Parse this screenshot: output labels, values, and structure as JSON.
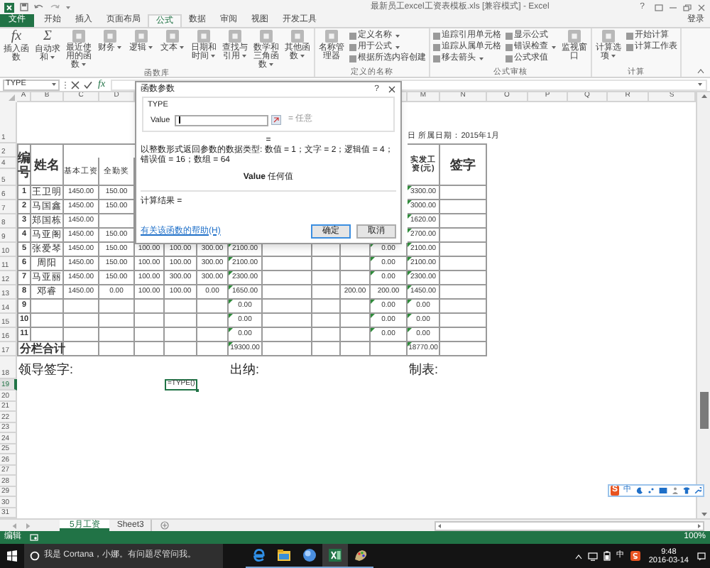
{
  "title_bar": {
    "title": "最新员工excel工资表模板.xls [兼容模式] - Excel",
    "help": "?"
  },
  "ribbon_tabs": [
    {
      "label": "文件",
      "kind": "file",
      "selected": false
    },
    {
      "label": "开始",
      "kind": "tab",
      "selected": false
    },
    {
      "label": "插入",
      "kind": "tab",
      "selected": false
    },
    {
      "label": "页面布局",
      "kind": "tab",
      "selected": false
    },
    {
      "label": "公式",
      "kind": "tab",
      "selected": true
    },
    {
      "label": "数据",
      "kind": "tab",
      "selected": false
    },
    {
      "label": "审阅",
      "kind": "tab",
      "selected": false
    },
    {
      "label": "视图",
      "kind": "tab",
      "selected": false
    },
    {
      "label": "开发工具",
      "kind": "tab",
      "selected": false
    }
  ],
  "sign_in": "登录",
  "ribbon_groups": [
    {
      "label": "函数库",
      "items": [
        {
          "label": "插入函数",
          "kind": "glyph",
          "glyph": "fx",
          "menu": false
        },
        {
          "label": "自动求和",
          "kind": "glyph",
          "glyph": "Σ",
          "menu": true
        },
        {
          "label": "最近使用的函数",
          "kind": "large",
          "menu": true
        },
        {
          "label": "财务",
          "kind": "large",
          "menu": true
        },
        {
          "label": "逻辑",
          "kind": "large",
          "menu": true
        },
        {
          "label": "文本",
          "kind": "large",
          "menu": true
        },
        {
          "label": "日期和时间",
          "kind": "large",
          "menu": true
        },
        {
          "label": "查找与引用",
          "kind": "large",
          "menu": true
        },
        {
          "label": "数学和三角函数",
          "kind": "large",
          "menu": true
        },
        {
          "label": "其他函数",
          "kind": "large",
          "menu": true
        }
      ]
    },
    {
      "label": "定义的名称",
      "items": [
        {
          "label": "名称管理器",
          "kind": "large",
          "menu": false
        },
        {
          "label": "定义名称",
          "kind": "small",
          "menu": true
        },
        {
          "label": "用于公式",
          "kind": "small",
          "menu": true
        },
        {
          "label": "根据所选内容创建",
          "kind": "small",
          "menu": false
        }
      ]
    },
    {
      "label": "公式审核",
      "items": [
        {
          "label": "追踪引用单元格",
          "kind": "small",
          "menu": false
        },
        {
          "label": "追踪从属单元格",
          "kind": "small",
          "menu": false
        },
        {
          "label": "移去箭头",
          "kind": "small",
          "menu": true
        },
        {
          "label": "显示公式",
          "kind": "small",
          "menu": false
        },
        {
          "label": "错误检查",
          "kind": "small",
          "menu": true
        },
        {
          "label": "公式求值",
          "kind": "small",
          "menu": false
        },
        {
          "label": "监视窗口",
          "kind": "large",
          "menu": false
        }
      ]
    },
    {
      "label": "计算",
      "items": [
        {
          "label": "计算选项",
          "kind": "large",
          "menu": true
        },
        {
          "label": "开始计算",
          "kind": "small",
          "menu": false
        },
        {
          "label": "计算工作表",
          "kind": "small",
          "menu": false
        }
      ]
    }
  ],
  "formula_bar": {
    "name_box": "TYPE",
    "fx": "fx"
  },
  "column_headers_left": [
    "A",
    "B",
    "C",
    "D"
  ],
  "column_headers_right": [
    "M",
    "N",
    "O",
    "P",
    "Q",
    "R",
    "S"
  ],
  "dialog": {
    "title": "函数参数",
    "help": "?",
    "function": "TYPE",
    "argument": {
      "label": "Value",
      "focused": true,
      "result": "= 任意"
    },
    "equals": "=",
    "description": "以整数形式返回参数的数据类型: 数值 = 1；文字 = 2；逻辑值 = 4；错误值 = 16；数组 = 64",
    "argument_help": "**Value**  任何值",
    "result": "计算结果 =",
    "help_link": "有关该函数的帮助(H)",
    "buttons": [
      {
        "label": "确定",
        "default": true
      },
      {
        "label": "取消",
        "default": false
      }
    ]
  },
  "rows": [
    {
      "number": "1",
      "kind": "title",
      "selected": false,
      "cells": {
        "L": "日 所属日期：2015年1月"
      }
    },
    {
      "number": "2",
      "kind": "header",
      "selected": false,
      "cells": {
        "A": {
          "text": "编号",
          "kind": "large"
        },
        "B": {
          "text": "姓名",
          "kind": "large"
        },
        "C": {
          "text": "基本工资",
          "kind": "sub"
        },
        "D": {
          "text": "全勤奖",
          "kind": "sub"
        },
        "M": {
          "text": "实发工资(元)",
          "kind": "small"
        },
        "N": {
          "text": "签字",
          "kind": "large"
        }
      }
    },
    {
      "number": "4",
      "kind": "merged",
      "selected": false
    },
    {
      "number": "5",
      "kind": "merged",
      "selected": false
    },
    {
      "number": "6",
      "kind": "data",
      "selected": false,
      "cells": {
        "A": "1",
        "B": "王卫明",
        "C": "1450.00",
        "D": "150.00",
        "M": {
          "text": "3300.00",
          "flag": true
        }
      }
    },
    {
      "number": "7",
      "kind": "data",
      "selected": false,
      "cells": {
        "A": "2",
        "B": "马国鑫",
        "C": "1450.00",
        "D": "150.00",
        "M": {
          "text": "3000.00",
          "flag": true
        }
      }
    },
    {
      "number": "8",
      "kind": "data",
      "selected": false,
      "cells": {
        "A": "3",
        "B": "郑国栋",
        "C": "1450.00",
        "M": {
          "text": "1620.00",
          "flag": true
        }
      }
    },
    {
      "number": "9",
      "kind": "data",
      "selected": false,
      "cells": {
        "A": "4",
        "B": "马亚阁",
        "C": "1450.00",
        "D": "150.00",
        "M": {
          "text": "2700.00",
          "flag": true
        }
      }
    },
    {
      "number": "10",
      "kind": "data",
      "selected": false,
      "cells": {
        "A": "5",
        "B": "张爱琴",
        "C": "1450.00",
        "D": "150.00",
        "E": "100.00",
        "F": "100.00",
        "G": "300.00",
        "H": {
          "text": "2100.00",
          "flag": true
        },
        "L": {
          "text": "0.00",
          "flag": true
        },
        "M": {
          "text": "2100.00",
          "flag": true
        }
      }
    },
    {
      "number": "11",
      "kind": "data",
      "selected": false,
      "cells": {
        "A": "6",
        "B": "周阳",
        "C": "1450.00",
        "D": "150.00",
        "E": "100.00",
        "F": "100.00",
        "G": "300.00",
        "H": {
          "text": "2100.00",
          "flag": true
        },
        "L": {
          "text": "0.00",
          "flag": true
        },
        "M": {
          "text": "2100.00",
          "flag": true
        }
      }
    },
    {
      "number": "12",
      "kind": "data",
      "selected": false,
      "cells": {
        "A": "7",
        "B": "马亚丽",
        "C": "1450.00",
        "D": "150.00",
        "E": "100.00",
        "F": "300.00",
        "G": "300.00",
        "H": {
          "text": "2300.00",
          "flag": true
        },
        "L": {
          "text": "0.00",
          "flag": true
        },
        "M": {
          "text": "2300.00",
          "flag": true
        }
      }
    },
    {
      "number": "13",
      "kind": "data",
      "selected": false,
      "cells": {
        "A": "8",
        "B": "邓睿",
        "C": "1450.00",
        "D": "0.00",
        "E": "100.00",
        "F": "100.00",
        "G": "0.00",
        "H": {
          "text": "1650.00",
          "flag": true
        },
        "K": "200.00",
        "L": {
          "text": "200.00",
          "flag": false
        },
        "M": {
          "text": "1450.00",
          "flag": true
        }
      }
    },
    {
      "number": "14",
      "kind": "data",
      "selected": false,
      "cells": {
        "A": "9",
        "H": {
          "text": "0.00",
          "flag": true
        },
        "L": {
          "text": "0.00",
          "flag": true
        },
        "M": {
          "text": "0.00",
          "flag": true
        }
      }
    },
    {
      "number": "15",
      "kind": "data",
      "selected": false,
      "cells": {
        "A": "10",
        "H": {
          "text": "0.00",
          "flag": true
        },
        "L": {
          "text": "0.00",
          "flag": true
        },
        "M": {
          "text": "0.00",
          "flag": true
        }
      }
    },
    {
      "number": "16",
      "kind": "data",
      "selected": false,
      "cells": {
        "A": "11",
        "H": {
          "text": "0.00",
          "flag": true
        },
        "L": {
          "text": "0.00",
          "flag": true
        },
        "M": {
          "text": "0.00",
          "flag": true
        }
      }
    },
    {
      "number": "17",
      "kind": "total",
      "selected": false,
      "cells": {
        "A": "分栏合计",
        "H": {
          "text": "19300.00",
          "flag": true
        },
        "M": {
          "text": "18770.00",
          "flag": true
        }
      }
    },
    {
      "number": "18",
      "kind": "signature",
      "selected": false,
      "cells": {
        "A": "领导签字:",
        "H": "出纳:",
        "M": "制表:"
      }
    },
    {
      "number": "19",
      "kind": "plain",
      "selected": true,
      "cells": {
        "F": {
          "text": "=TYPE()",
          "active": true
        }
      }
    },
    {
      "number": "20",
      "kind": "plain",
      "selected": false
    },
    {
      "number": "21",
      "kind": "plain",
      "selected": false
    },
    {
      "number": "22",
      "kind": "plain",
      "selected": false
    },
    {
      "number": "23",
      "kind": "plain",
      "selected": false
    },
    {
      "number": "24",
      "kind": "plain",
      "selected": false
    },
    {
      "number": "25",
      "kind": "plain",
      "selected": false
    },
    {
      "number": "26",
      "kind": "plain",
      "selected": false
    },
    {
      "number": "27",
      "kind": "plain",
      "selected": false
    },
    {
      "number": "28",
      "kind": "plain",
      "selected": false
    },
    {
      "number": "29",
      "kind": "plain",
      "selected": false
    },
    {
      "number": "30",
      "kind": "plain",
      "selected": false
    },
    {
      "number": "31",
      "kind": "plain",
      "selected": false
    }
  ],
  "sheet_tabs": [
    {
      "label": "5月工资",
      "selected": true
    },
    {
      "label": "Sheet3",
      "selected": false
    }
  ],
  "ime_bar": {
    "logo": "S",
    "mode": "中"
  },
  "status_bar": {
    "mode": "编辑",
    "zoom": "100%"
  },
  "taskbar": {
    "search": "我是 Cortana，小娜。有问题尽管问我。",
    "input_mode": "中",
    "time": "9:48",
    "date": "2016-03-14"
  }
}
